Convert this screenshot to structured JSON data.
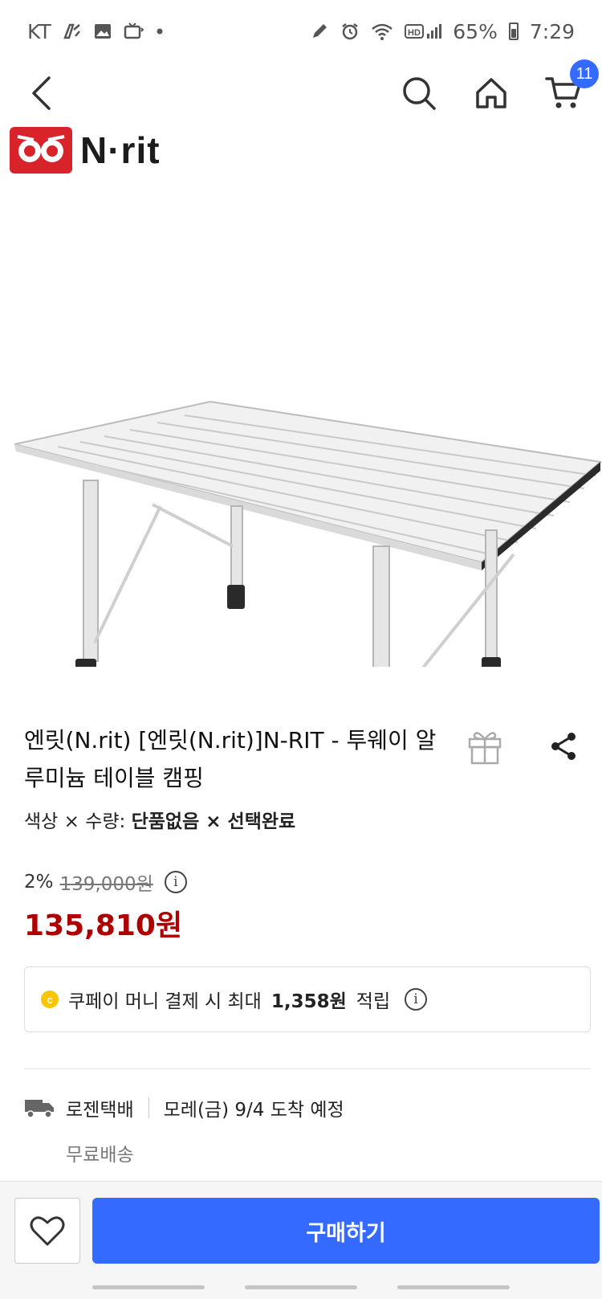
{
  "status_bar": {
    "carrier": "KT",
    "battery": "65%",
    "time": "7:29"
  },
  "header": {
    "cart_count": "11"
  },
  "product": {
    "brand_logo_text": "N·rit",
    "title": "엔릿(N.rit) [엔릿(N.rit)]N-RIT - 투웨이 알루미늄 테이블 캠핑",
    "option_label": "색상 × 수량:",
    "option_value": "단품없음 × 선택완료",
    "discount_rate": "2%",
    "original_price": "139,000원",
    "sale_price": "135,810원"
  },
  "reward": {
    "coin_symbol": "c",
    "text_prefix": "쿠페이 머니 결제 시 최대",
    "amount": "1,358원",
    "text_suffix": "적립"
  },
  "shipping": {
    "carrier": "로젠택배",
    "eta": "모레(금) 9/4 도착 예정",
    "fee": "무료배송"
  },
  "bottom_bar": {
    "buy_label": "구매하기"
  },
  "colors": {
    "accent": "#346aff",
    "price_red": "#ae0000",
    "logo_red": "#d9232a"
  },
  "icons": [
    "back-arrow-icon",
    "search-icon",
    "home-icon",
    "cart-icon",
    "gift-icon",
    "share-icon",
    "info-icon",
    "coin-icon",
    "truck-icon",
    "heart-icon"
  ]
}
